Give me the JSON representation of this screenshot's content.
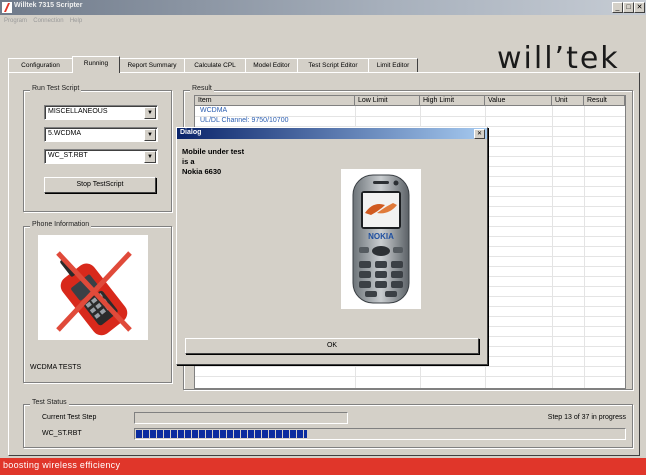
{
  "window": {
    "title": "Willtek 7315 Scripter",
    "controls": {
      "minimize": "_",
      "maximize": "□",
      "close": "✕"
    }
  },
  "menu": [
    "Program",
    "Connection",
    "Help"
  ],
  "brand": {
    "logo_text": "will’tek",
    "tagline": "boosting wireless efficiency",
    "accent_color": "#e0362a"
  },
  "tabs": [
    "Configuration",
    "Running",
    "Report Summary",
    "Calculate CPL",
    "Model Editor",
    "Test Script Editor",
    "Limit Editor"
  ],
  "active_tab": "Running",
  "run_test_script": {
    "label": "Run Test Script",
    "combos": [
      "MISCELLANEOUS",
      "5.WCDMA",
      "WC_ST.RBT"
    ],
    "stop_button": "Stop TestScript"
  },
  "phone_info": {
    "label": "Phone Information",
    "caption": "WCDMA TESTS"
  },
  "result": {
    "label": "Result",
    "columns": [
      "Item",
      "Low Limit",
      "High Limit",
      "Value",
      "Unit",
      "Result"
    ],
    "rows": [
      "WCDMA",
      "UL/DL Channel: 9750/10700"
    ]
  },
  "dialog": {
    "title": "Dialog",
    "lines": [
      "Mobile under test",
      "is a",
      "Nokia 6630"
    ],
    "ok_button": "OK",
    "phone_brand": "NOKIA"
  },
  "test_status": {
    "label": "Test Status",
    "current_step_label": "Current Test Step",
    "script_name": "WC_ST.RBT",
    "step_text": "Step 13 of 37 in progress",
    "progress_fraction": 0.351
  }
}
